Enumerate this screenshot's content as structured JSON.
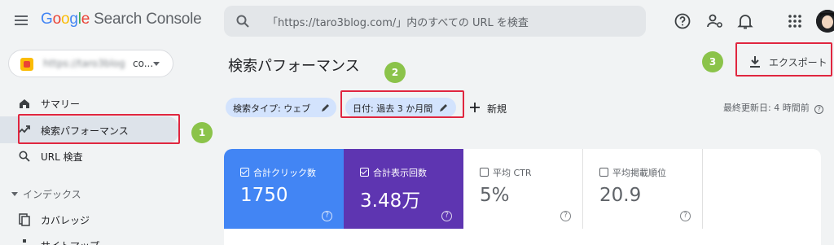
{
  "header": {
    "logo_letters": [
      "G",
      "o",
      "o",
      "g",
      "l",
      "e"
    ],
    "product": "Search Console",
    "search_placeholder": "「https://taro3blog.com/」内のすべての URL を検査",
    "icons": [
      "help-icon",
      "manage-users-icon",
      "notifications-icon",
      "apps-icon"
    ]
  },
  "sidebar": {
    "property_blurred": "https://taro3blog",
    "property_suffix": "co...",
    "items": [
      {
        "label": "サマリー",
        "icon": "home-icon"
      },
      {
        "label": "検索パフォーマンス",
        "icon": "trend-icon",
        "active": true
      },
      {
        "label": "URL 検査",
        "icon": "search-icon"
      }
    ],
    "section": "インデックス",
    "section_items": [
      {
        "label": "カバレッジ",
        "icon": "coverage-icon"
      },
      {
        "label": "サイトマップ",
        "icon": "sitemap-icon"
      }
    ]
  },
  "main": {
    "title": "検索パフォーマンス",
    "export_label": "エクスポート",
    "filters": [
      {
        "label": "検索タイプ: ウェブ"
      },
      {
        "label": "日付: 過去 3 か月間"
      }
    ],
    "new_label": "新規",
    "updated": "最終更新日: 4 時間前"
  },
  "metrics": [
    {
      "label": "合計クリック数",
      "value": "1750",
      "checked": true
    },
    {
      "label": "合計表示回数",
      "value": "3.48万",
      "checked": true
    },
    {
      "label": "平均 CTR",
      "value": "5%",
      "checked": false
    },
    {
      "label": "平均掲載順位",
      "value": "20.9",
      "checked": false
    }
  ],
  "annotations": {
    "badges": [
      "1",
      "2",
      "3"
    ],
    "box_color": "#e0263f",
    "badge_color": "#8bc34a"
  },
  "colors": {
    "clicks": "#4285f4",
    "impressions": "#5e35b1"
  }
}
